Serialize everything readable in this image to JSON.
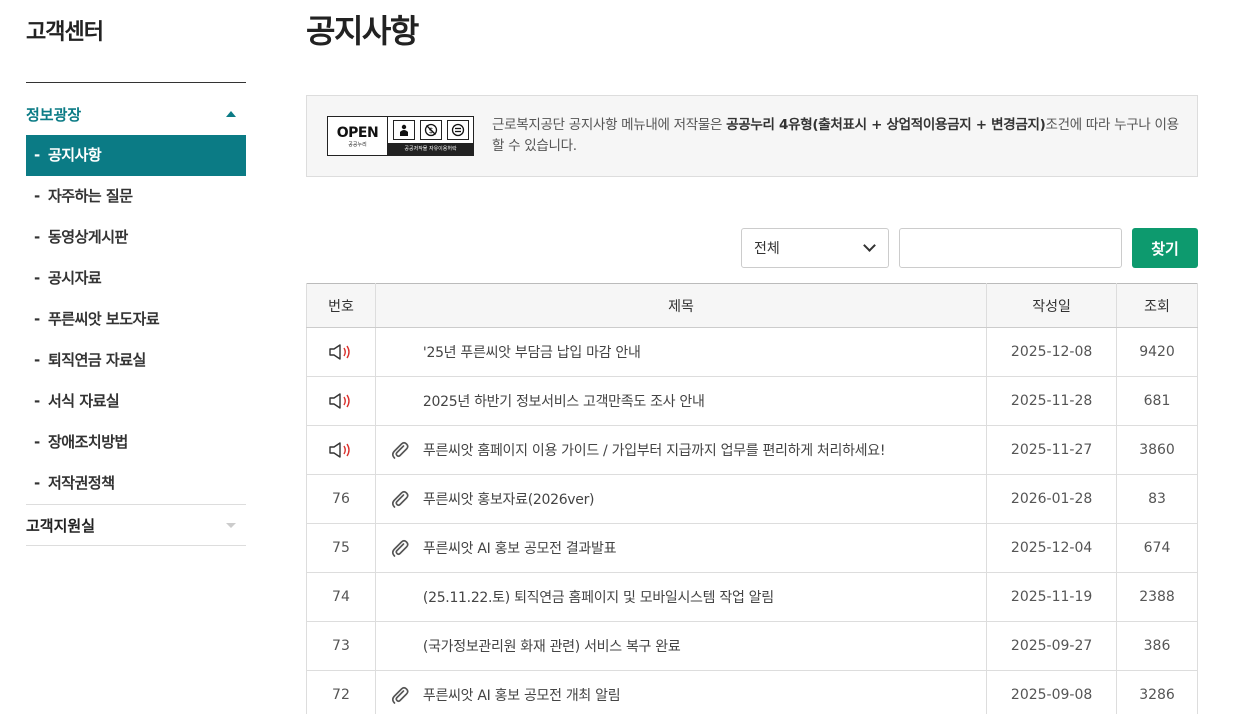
{
  "sidebar": {
    "title": "고객센터",
    "section_info": "정보광장",
    "items": [
      {
        "label": "공지사항",
        "active": true
      },
      {
        "label": "자주하는 질문"
      },
      {
        "label": "동영상게시판"
      },
      {
        "label": "공시자료"
      },
      {
        "label": "푸른씨앗 보도자료"
      },
      {
        "label": "퇴직연금 자료실"
      },
      {
        "label": "서식 자료실"
      },
      {
        "label": "장애조치방법"
      },
      {
        "label": "저작권정책"
      }
    ],
    "section_support": "고객지원실",
    "dash": "-"
  },
  "page": {
    "title": "공지사항"
  },
  "license": {
    "badge_word": "OPEN",
    "badge_sub": "공공누리",
    "badge_bottom": "공공저작물 자유이용허락",
    "text_pre": "근로복지공단 공지사항 메뉴내에 저작물은 ",
    "text_bold": "공공누리 4유형(출처표시 + 상업적이용금지 + 변경금지)",
    "text_post": "조건에 따라 누구나 이용할 수 있습니다."
  },
  "search": {
    "select_value": "전체",
    "input_value": "",
    "button_label": "찾기"
  },
  "table": {
    "headers": {
      "no": "번호",
      "title": "제목",
      "date": "작성일",
      "views": "조회"
    },
    "rows": [
      {
        "no": "",
        "notice": true,
        "attach": false,
        "title": "'25년 푸른씨앗 부담금 납입 마감 안내",
        "date": "2025-12-08",
        "views": "9420"
      },
      {
        "no": "",
        "notice": true,
        "attach": false,
        "title": "2025년 하반기 정보서비스 고객만족도 조사 안내",
        "date": "2025-11-28",
        "views": "681"
      },
      {
        "no": "",
        "notice": true,
        "attach": true,
        "title": "푸른씨앗 홈페이지 이용 가이드 / 가입부터 지급까지 업무를 편리하게 처리하세요!",
        "date": "2025-11-27",
        "views": "3860"
      },
      {
        "no": "76",
        "notice": false,
        "attach": true,
        "title": "푸른씨앗 홍보자료(2026ver)",
        "date": "2026-01-28",
        "views": "83"
      },
      {
        "no": "75",
        "notice": false,
        "attach": true,
        "title": "푸른씨앗 AI 홍보 공모전 결과발표",
        "date": "2025-12-04",
        "views": "674"
      },
      {
        "no": "74",
        "notice": false,
        "attach": false,
        "title": "(25.11.22.토) 퇴직연금 홈페이지 및 모바일시스템 작업 알림",
        "date": "2025-11-19",
        "views": "2388"
      },
      {
        "no": "73",
        "notice": false,
        "attach": false,
        "title": "(국가정보관리원 화재 관련) 서비스 복구 완료",
        "date": "2025-09-27",
        "views": "386"
      },
      {
        "no": "72",
        "notice": false,
        "attach": true,
        "title": "푸른씨앗 AI 홍보 공모전 개최 알림",
        "date": "2025-09-08",
        "views": "3286"
      }
    ]
  },
  "colors": {
    "accent": "#0b7b85",
    "button": "#0d9a6e",
    "speaker_wave": "#d9302c"
  },
  "icons": {
    "notice": "speaker-icon",
    "attachment": "paperclip-icon",
    "expand": "chevron-down-icon",
    "collapse": "caret-up-icon"
  }
}
